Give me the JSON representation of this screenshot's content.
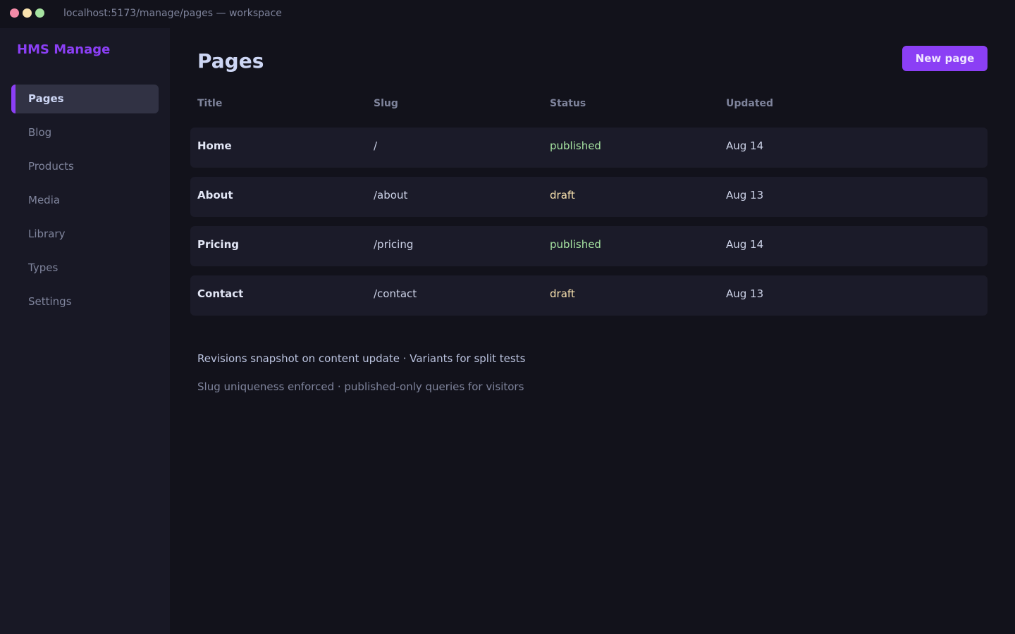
{
  "window": {
    "url": "localhost:5173/manage/pages — workspace"
  },
  "sidebar": {
    "brand": "HMS Manage",
    "items": [
      {
        "label": "Pages",
        "active": true
      },
      {
        "label": "Blog"
      },
      {
        "label": "Products"
      },
      {
        "label": "Media"
      },
      {
        "label": "Library"
      },
      {
        "label": "Types"
      },
      {
        "label": "Settings"
      }
    ]
  },
  "main": {
    "title": "Pages",
    "new_button": "New page",
    "columns": [
      "Title",
      "Slug",
      "Status",
      "Updated"
    ],
    "rows": [
      {
        "title": "Home",
        "slug": "/",
        "status": "published",
        "updated": "Aug 14"
      },
      {
        "title": "About",
        "slug": "/about",
        "status": "draft",
        "updated": "Aug 13"
      },
      {
        "title": "Pricing",
        "slug": "/pricing",
        "status": "published",
        "updated": "Aug 14"
      },
      {
        "title": "Contact",
        "slug": "/contact",
        "status": "draft",
        "updated": "Aug 13"
      }
    ],
    "note_primary": "Revisions snapshot on content update · Variants for split tests",
    "note_secondary": "Slug uniqueness enforced · published-only queries for visitors"
  },
  "colors": {
    "accent": "#8b3ff5",
    "published": "#a6e3a1",
    "draft": "#f9e2af"
  }
}
